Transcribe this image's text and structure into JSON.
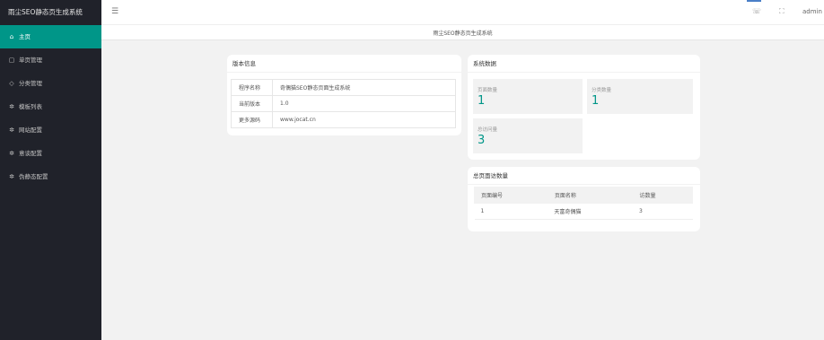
{
  "app": {
    "logo_text": "雨尘SEO静态页生成系统"
  },
  "sidebar": {
    "items": [
      {
        "label": "主页",
        "icon": "home-icon",
        "glyph": "⌂"
      },
      {
        "label": "单页管理",
        "icon": "page-icon",
        "glyph": "▢"
      },
      {
        "label": "分类管理",
        "icon": "tag-icon",
        "glyph": "◇"
      },
      {
        "label": "模板列表",
        "icon": "gear-icon",
        "glyph": "✲"
      },
      {
        "label": "网站配置",
        "icon": "gear-icon",
        "glyph": "✲"
      },
      {
        "label": "意谈配置",
        "icon": "gear-icon",
        "glyph": "✲"
      },
      {
        "label": "伪静态配置",
        "icon": "gear-icon",
        "glyph": "✲"
      }
    ]
  },
  "header": {
    "menu_glyph": "☰",
    "message_glyph": "☏",
    "fullscreen_glyph": "⛶",
    "user": "admin"
  },
  "tab": {
    "title": "雨尘SEO静态页生成系统"
  },
  "version_card": {
    "title": "版本信息",
    "rows": [
      {
        "key": "程序名称",
        "value": "奇偶猫SEO静态页面生成系统"
      },
      {
        "key": "当前版本",
        "value": "1.0"
      },
      {
        "key": "更多源码",
        "value": "www.jocat.cn"
      }
    ]
  },
  "system_card": {
    "title": "系统数据",
    "stats": [
      {
        "label": "页面数量",
        "value": "1"
      },
      {
        "label": "分类数量",
        "value": "1"
      },
      {
        "label": "总访问量",
        "value": "3"
      }
    ]
  },
  "pages_card": {
    "title": "总页面访数量",
    "columns": [
      "页面编号",
      "页面名称",
      "访数量"
    ],
    "rows": [
      [
        "1",
        "天富奇偶猫",
        "3"
      ]
    ]
  },
  "colors": {
    "accent": "#009688",
    "sidebar_bg": "#20222a"
  }
}
